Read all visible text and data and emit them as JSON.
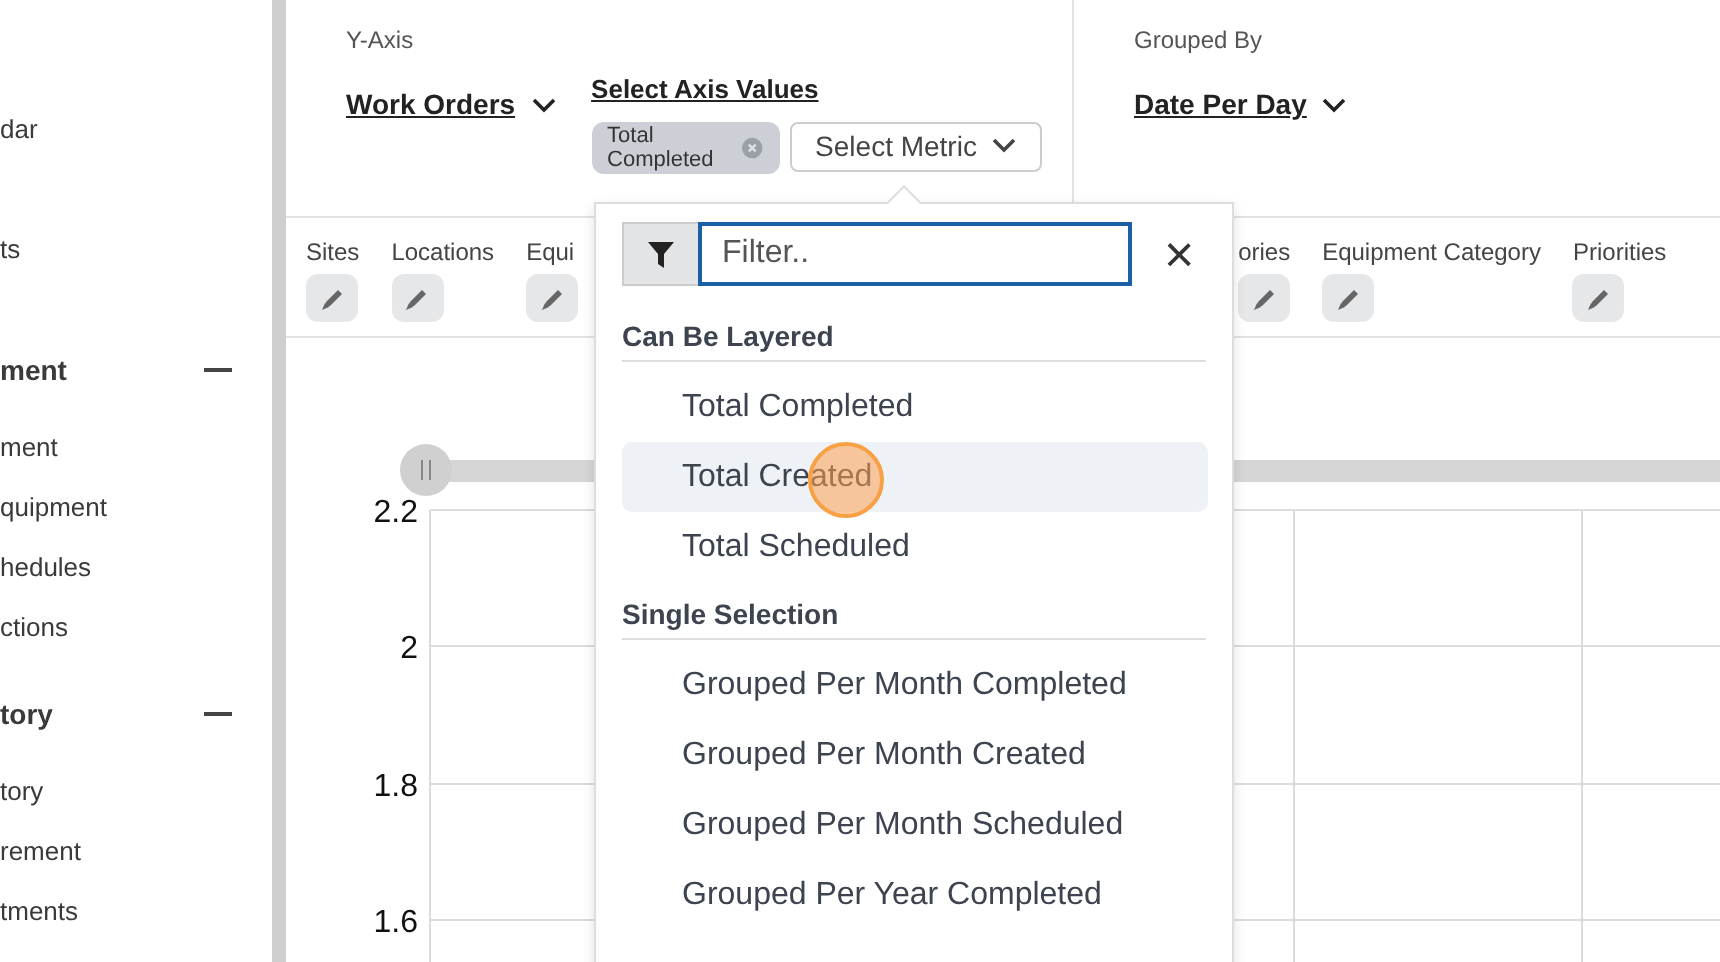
{
  "sidebar": {
    "items": [
      {
        "label": "dar",
        "kind": "link"
      },
      {
        "label": "ts",
        "kind": "link"
      },
      {
        "label": "ment",
        "kind": "section",
        "expanded": true,
        "children": [
          {
            "label": "ment"
          },
          {
            "label": "quipment"
          },
          {
            "label": "hedules"
          },
          {
            "label": "ctions"
          }
        ]
      },
      {
        "label": "tory",
        "kind": "section",
        "expanded": true,
        "children": [
          {
            "label": "tory"
          },
          {
            "label": "rement"
          },
          {
            "label": "tments"
          }
        ]
      }
    ]
  },
  "y_axis": {
    "caption": "Y-Axis",
    "source": "Work Orders",
    "values_link": "Select Axis Values",
    "chips": [
      {
        "label": "Total Completed"
      }
    ],
    "metric_button": "Select Metric"
  },
  "grouped_by": {
    "caption": "Grouped By",
    "value": "Date Per Day"
  },
  "filters": [
    {
      "label": "Sites"
    },
    {
      "label": "Locations"
    },
    {
      "label": "Equi"
    },
    {
      "label": "ories"
    },
    {
      "label": "Equipment Category"
    },
    {
      "label": "Priorities"
    }
  ],
  "chart": {
    "y_ticks": [
      "2.2",
      "2",
      "1.8",
      "1.6"
    ]
  },
  "metric_menu": {
    "filter_placeholder": "Filter..",
    "close": "×",
    "groups": [
      {
        "title": "Can Be Layered",
        "items": [
          {
            "label": "Total Completed",
            "hovered": false
          },
          {
            "label": "Total Created",
            "hovered": true
          },
          {
            "label": "Total Scheduled",
            "hovered": false
          }
        ]
      },
      {
        "title": "Single Selection",
        "items": [
          {
            "label": "Grouped Per Month Completed",
            "hovered": false
          },
          {
            "label": "Grouped Per Month Created",
            "hovered": false
          },
          {
            "label": "Grouped Per Month Scheduled",
            "hovered": false
          },
          {
            "label": "Grouped Per Year Completed",
            "hovered": false
          }
        ]
      }
    ]
  }
}
